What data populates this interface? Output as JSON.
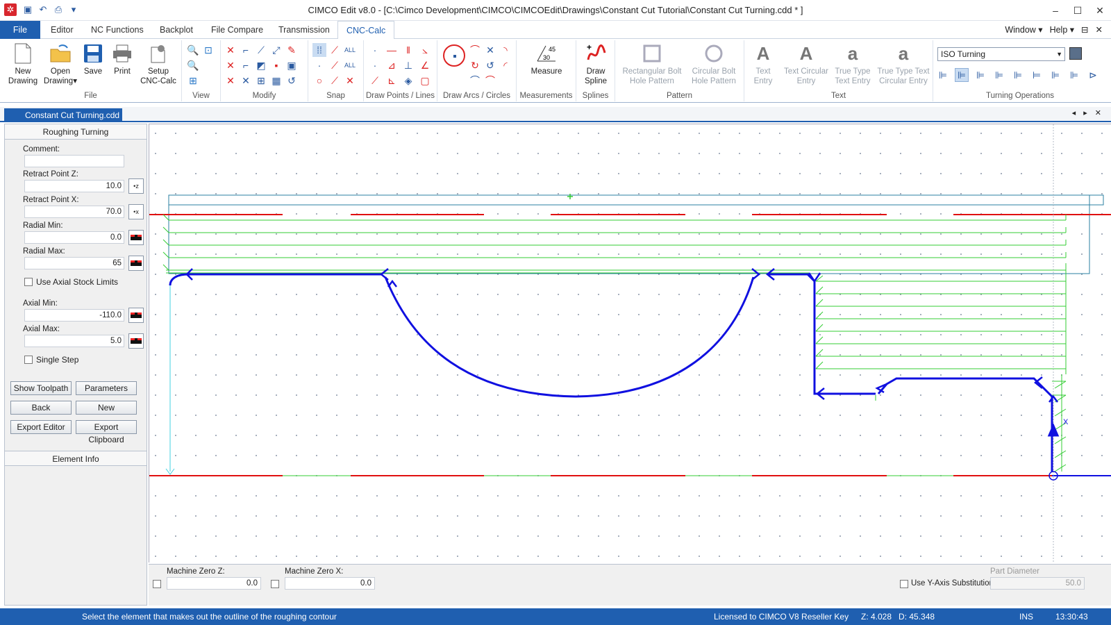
{
  "window": {
    "title": "CIMCO Edit v8.0 - [C:\\Cimco Development\\CIMCO\\CIMCOEdit\\Drawings\\Constant Cut Tutorial\\Constant Cut Turning.cdd * ]",
    "controls": [
      "–",
      "☐",
      "✕"
    ]
  },
  "menu": {
    "tabs": [
      "File",
      "Editor",
      "NC Functions",
      "Backplot",
      "File Compare",
      "Transmission",
      "CNC-Calc"
    ],
    "active": "CNC-Calc",
    "right": [
      "Window ▾",
      "Help ▾",
      "⊟",
      "✕"
    ]
  },
  "ribbon": {
    "file_group": {
      "label": "File",
      "buttons": [
        {
          "l1": "New",
          "l2": "Drawing"
        },
        {
          "l1": "Open",
          "l2": "Drawing▾"
        },
        {
          "l1": "Save",
          "l2": ""
        },
        {
          "l1": "Print",
          "l2": ""
        },
        {
          "l1": "Setup",
          "l2": "CNC-Calc"
        }
      ]
    },
    "groups": [
      "View",
      "Modify",
      "Snap",
      "Draw Points / Lines",
      "Draw Arcs / Circles",
      "Measurements",
      "Splines",
      "Pattern",
      "Text",
      "Turning Operations"
    ],
    "measure": {
      "l1": "Measure",
      "angle_top": "45",
      "angle_bottom": "30"
    },
    "spline": {
      "l1": "Draw",
      "l2": "Spline"
    },
    "pattern": [
      {
        "l1": "Rectangular Bolt",
        "l2": "Hole Pattern"
      },
      {
        "l1": "Circular Bolt",
        "l2": "Hole Pattern"
      }
    ],
    "text": [
      {
        "l1": "Text",
        "l2": "Entry"
      },
      {
        "l1": "Text Circular",
        "l2": "Entry"
      },
      {
        "l1": "True Type",
        "l2": "Text Entry"
      },
      {
        "l1": "True Type Text",
        "l2": "Circular Entry"
      }
    ],
    "turning_combo": "ISO Turning"
  },
  "doc_tab": {
    "label": "Constant Cut Turning.cdd *",
    "nav": "◂ ▸ ✕"
  },
  "panel": {
    "title": "Roughing Turning",
    "comment_label": "Comment:",
    "comment_value": "",
    "retract_z_label": "Retract Point Z:",
    "retract_z": "10.0",
    "retract_x_label": "Retract Point X:",
    "retract_x": "70.0",
    "radial_min_label": "Radial Min:",
    "radial_min": "0.0",
    "radial_max_label": "Radial Max:",
    "radial_max": "65",
    "use_axial_label": "Use Axial Stock Limits",
    "axial_min_label": "Axial Min:",
    "axial_min": "-110.0",
    "axial_max_label": "Axial Max:",
    "axial_max": "5.0",
    "single_step_label": "Single Step",
    "buttons": {
      "show_toolpath": "Show Toolpath",
      "parameters": "Parameters",
      "back": "Back",
      "new": "New",
      "export_editor": "Export Editor",
      "export_clipboard": "Export Clipboard"
    },
    "element_info": "Element Info",
    "pick_z": "•z",
    "pick_x": "•x"
  },
  "bottom": {
    "mz_z_label": "Machine Zero Z:",
    "mz_z": "0.0",
    "mz_x_label": "Machine Zero X:",
    "mz_x": "0.0",
    "y_sub_label": "Use Y-Axis Substitution",
    "part_diam_label": "Part Diameter",
    "part_diam": "50.0"
  },
  "status": {
    "message": "Select the element that makes out the outline of the roughing contour",
    "license": "Licensed to CIMCO V8 Reseller Key",
    "coords": "Z: 4.028   D: 45.348",
    "ins": "INS",
    "time": "13:30:43"
  },
  "drawing": {
    "x_axis_label": "X",
    "colors": {
      "contour": "#1010e0",
      "toolpath": "#33cc33",
      "stock": "#2a7fa0",
      "centerline": "#e01010",
      "guide": "#40d0e0"
    }
  }
}
